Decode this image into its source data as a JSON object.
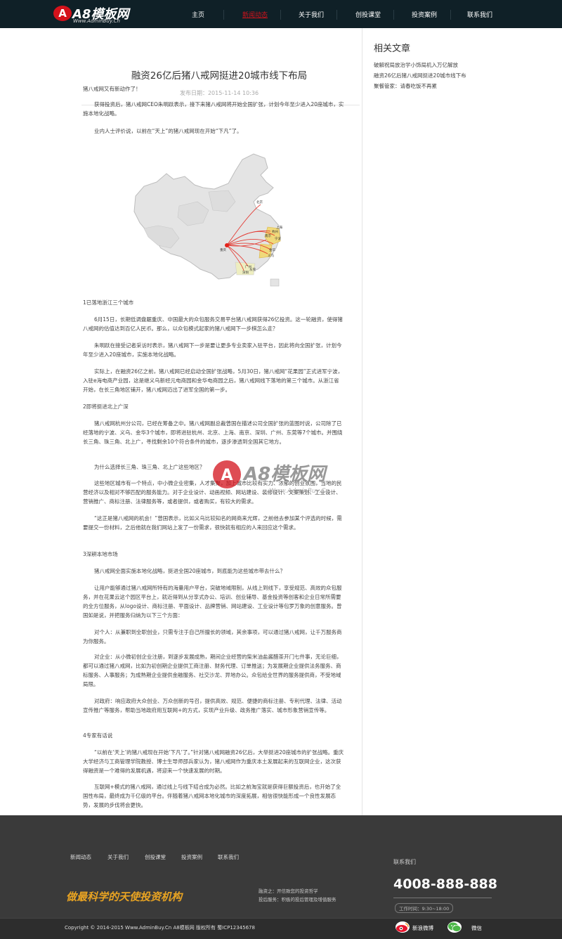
{
  "header": {
    "logo_mark": "A",
    "logo_text": "A8模板网",
    "logo_url": "Www.AdminBuy.Cn",
    "nav": [
      {
        "label": "主页"
      },
      {
        "label": "新闻动态",
        "active": true
      },
      {
        "label": "关于我们"
      },
      {
        "label": "创投课堂"
      },
      {
        "label": "投资案例"
      },
      {
        "label": "联系我们"
      }
    ]
  },
  "article": {
    "title": "融资26亿后猪八戒网挺进20城市线下布局",
    "date": "发布日期：2015-11-14 10:36",
    "paragraphs": [
      "猪八戒网又有新动作了！",
      "获得投资后，猪八戒网CEO朱明跃表示，接下来猪八戒网将开始全国扩张，计划今年至少进入20座城市，实施本地化战略。",
      "业内人士评价说，以前在“天上”的猪八戒网现在开始“下凡”了。",
      "1已落地浙江三个城市",
      "6月15日，长期低调盘踞重庆、中国最大的众包服务交易平台猪八戒网获得26亿投资。这一轮融资，使得猪八戒网的估值达到百亿人民币。那么，以众包模式起家的猪八戒网下一步棋怎么走？",
      "朱明跃在接受记者采访时表示，猪八戒网下一步是要让更多专业卖家入驻平台，因此将向全国扩张，计划今年至少进入20座城市，实施本地化战略。",
      "实际上，在融资26亿之前，猪八戒网已经启动全国扩张战略，5月30日，猪八戒网“花果园”正式进军宁波，入驻e海电商产业园，这是继义乌新经元电商园和金华电商园之后，猪八戒网线下落地的第三个城市。从浙江省开始，在长三角地区铺开，猪八戒网迈出了进军全国的第一步。",
      "2即将挺进北上广深",
      "猪八戒网杭州分公司，已经在筹备之中。猪八戒网副总裁曾国在描述公司全国扩张的蓝图时说，公司除了已经落地的宁波、义乌、金华3个城市，即将进驻杭州、北京、上海、南京、深圳、广州、东莞等7个城市。并围绕长三角、珠三角、北上广，寻找剩余10个符合条件的城市，逐步渗透到全国其它地方。",
      "为什么选择长三角、珠三角、北上广这些地区？",
      "这些地区城市有一个特点，中小微企业密集，人才集聚，加上城市比较有实力、浓郁的创业氛围，当地的民营经济以及相对不够匹配的服务能力。对于企业设计、动画视频、网站建设、装修设计、文案策划、工业设计、营销推广、商标注册、法律服务等，或者提供，或者购买，有较大的需求。",
      "“这正是猪八戒网的机会！”曾国表示，比如义乌比较知名的网商来光辉，之前他去参加某个评选的时候，需要提交一份材料，之后他就在我们网站上发了一份需求，很快就有相应的人来回应这个需求。",
      "3深耕本地市场",
      "猪八戒网全面实施本地化战略，挺进全国20座城市，到底能为这些城市带去什么？",
      "让用户能够通过猪八戒网所特有的海量用户平台，突破地域限制，从线上到线下，享受规范、高效的众包服务，并在花果云这个园区平台上，就近得到从分享式办公、培训、创业辅导、基金投资等创客和企业日常所需要的全方位服务，从logo设计、商标注册、平面设计、品牌营销、网站建设、工业设计等包罗万象的创意服务。曾国如是说，并把服务归纳为以下三个方面：",
      "对个人：从兼职到全职创业，只需专注于自己所擅长的领域，其余事项，可以通过猪八戒网，让千万服务商为你服务。",
      "对企业：从小微初创企业注册，到逐步发展成熟，期间企业经营的柴米油盐酱醋茶开门七件事，无论巨细，都可以通过猪八戒网，比如为初创期企业提供工商注册、财务代理、订单推送；为发展期企业提供法务服务、商标服务、人事服务；为成熟期企业提供金融服务、社交沙龙、异地办公。众包给全世界的服务提供商，不受地域局限。",
      "对政府：响应政府大众创业、万众创新的号召，提供高效、规范、便捷的商标注册、专利代理、法律、活动宣传推广等服务，帮助当地政府用互联网+的方式，实现产业升级、政务推广落实、城市形象营销宣传等。",
      "4专家有话说",
      "“以前在‘天上’的猪八戒现在开始‘下凡’了。”针对猪八戒网融资26亿后，大举挺进20座城市的扩张战略。重庆大学经济与工商管理学院教授、博士生导师邵兵家认为，猪八戒网作为重庆本土发展起来的互联网企业，这次获得融资是一个难得的发展机遇，将迎来一个快速发展的时期。",
      "互联网+模式的猪八戒网，通过线上与线下结合成为必然。比如之前淘宝就是获得巨额投资后，也开始了全国性布局，最终成为千亿级的平台。伴随着猪八戒网本地化城市的深度拓展，相信很快能形成一个良性发展态势，发展的步伐将会更快。"
    ]
  },
  "map": {
    "labels": [
      "北京",
      "宁波",
      "金华",
      "义乌",
      "杭州",
      "南京",
      "上海",
      "深圳",
      "广州",
      "东莞"
    ],
    "origin": "重庆"
  },
  "watermark": {
    "text": "A8模板网",
    "url": "Www.AdminBuy.Cn"
  },
  "sidebar": {
    "title": "相关文章",
    "items": [
      "破解祝局放治学小饰局机入万亿解放",
      "融资26亿后猪八戒网挺进20城市线下布",
      "聚餐管家：请春吃饭不再累"
    ]
  },
  "footer": {
    "nav": [
      "新闻动态",
      "关于我们",
      "创投课堂",
      "投资案例",
      "联系我们"
    ],
    "slogan": "做最科学的天使投资机构",
    "info1": "融资之：开信致您的投资哲学",
    "info2": "投后服务：积极的投后管理及增值服务",
    "contact_label": "联系我们",
    "phone": "4008-888-888",
    "hours": "工作时间：9:30~18:00",
    "copyright": "Copyright © 2014-2015 Www.AdminBuy.Cn A8模板网 版权所有 蜀ICP12345678",
    "weibo": "新浪微博",
    "wechat": "微信"
  },
  "colors": {
    "topbar": "#0f2027",
    "accent": "#d4121b",
    "footer": "#3a3a3a",
    "slogan": "#e8a322"
  }
}
